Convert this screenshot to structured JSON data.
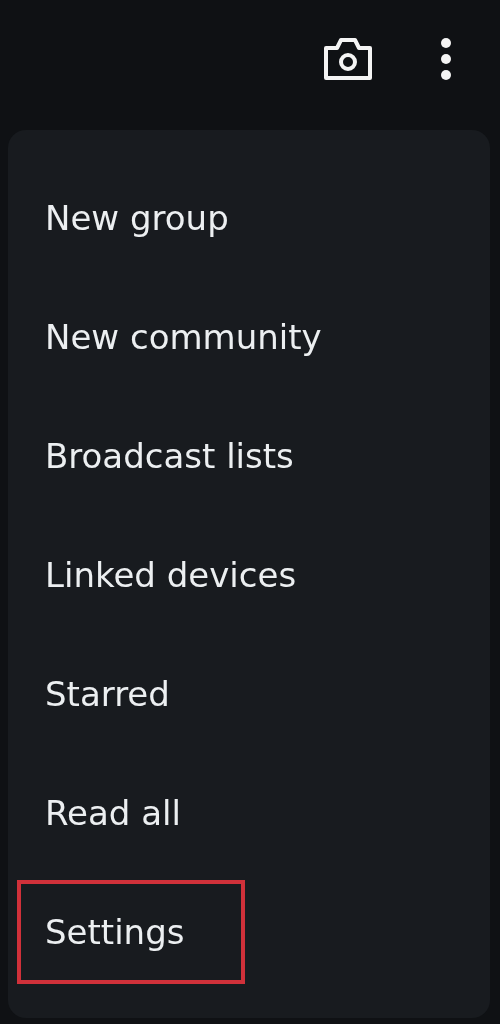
{
  "menu": {
    "items": [
      {
        "label": "New group",
        "highlighted": false
      },
      {
        "label": "New community",
        "highlighted": false
      },
      {
        "label": "Broadcast lists",
        "highlighted": false
      },
      {
        "label": "Linked devices",
        "highlighted": false
      },
      {
        "label": "Starred",
        "highlighted": false
      },
      {
        "label": "Read all",
        "highlighted": false
      },
      {
        "label": "Settings",
        "highlighted": true
      }
    ]
  }
}
